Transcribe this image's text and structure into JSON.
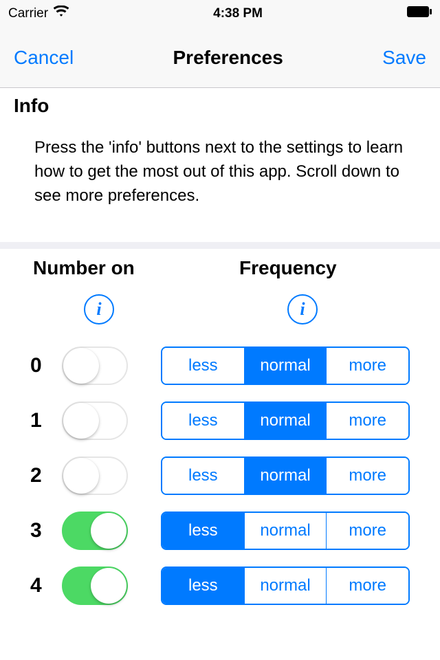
{
  "status": {
    "carrier": "Carrier",
    "time": "4:38 PM"
  },
  "nav": {
    "cancel": "Cancel",
    "title": "Preferences",
    "save": "Save"
  },
  "section": {
    "info_header": "Info"
  },
  "info_text": "Press the 'info' buttons next to the settings to learn how to get the most out of this app. Scroll down to see more preferences.",
  "columns": {
    "number_on": "Number on",
    "frequency": "Frequency"
  },
  "segments": {
    "less": "less",
    "normal": "normal",
    "more": "more"
  },
  "rows": [
    {
      "label": "0",
      "on": false,
      "freq": "normal"
    },
    {
      "label": "1",
      "on": false,
      "freq": "normal"
    },
    {
      "label": "2",
      "on": false,
      "freq": "normal"
    },
    {
      "label": "3",
      "on": true,
      "freq": "less"
    },
    {
      "label": "4",
      "on": true,
      "freq": "less"
    }
  ]
}
